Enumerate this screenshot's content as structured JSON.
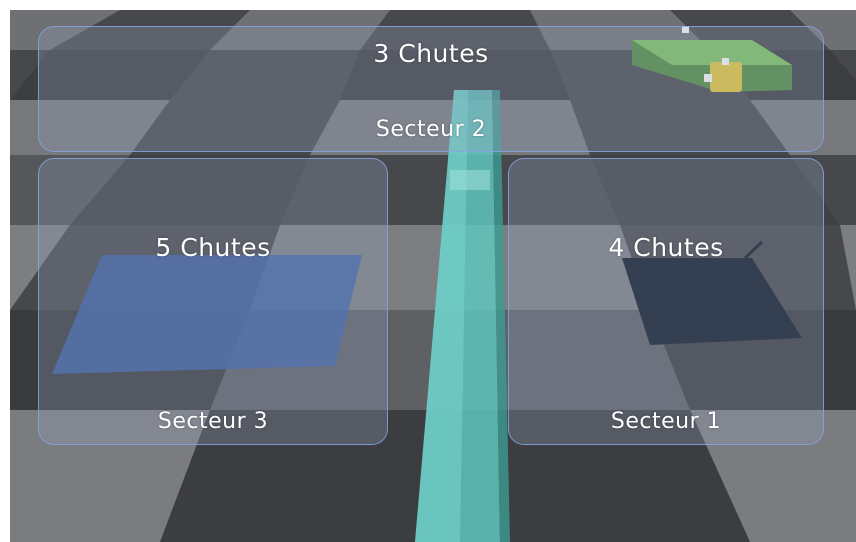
{
  "hud": {
    "sector_top": {
      "chutes": "3 Chutes",
      "name": "Secteur 2"
    },
    "sector_left": {
      "chutes": "5 Chutes",
      "name": "Secteur 3"
    },
    "sector_right": {
      "chutes": "4 Chutes",
      "name": "Secteur 1"
    }
  },
  "colors": {
    "panel_border": "#82a5e1",
    "wall": "#5fc6bd",
    "blue_tile": "#3b5fa5",
    "dark_tile": "#0f1a28",
    "robot_body": "#4f8a3f",
    "robot_sensor": "#e0c23a"
  }
}
